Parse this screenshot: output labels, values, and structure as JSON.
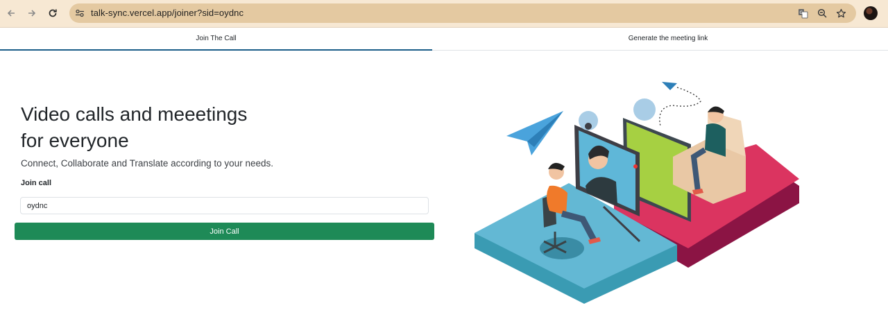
{
  "browser": {
    "url": "talk-sync.vercel.app/joiner?sid=oydnc",
    "back_icon": "arrow-left-icon",
    "forward_icon": "arrow-right-icon",
    "reload_icon": "reload-icon",
    "site_info_icon": "tune-icon",
    "translate_icon": "translate-icon",
    "zoom_icon": "zoom-out-icon",
    "bookmark_icon": "star-icon"
  },
  "tabs": [
    {
      "label": "Join The Call",
      "active": true
    },
    {
      "label": "Generate the meeting link",
      "active": false
    }
  ],
  "main": {
    "headline": "Video calls and meeetings for everyone",
    "subtitle": "Connect, Collaborate and Translate according to your needs.",
    "join_label": "Join call",
    "sid_value": "oydnc",
    "join_button": "Join Call"
  },
  "colors": {
    "accent": "#1e8a57",
    "tab_underline": "#1a5d88",
    "omnibox": "#e4c9a1"
  }
}
